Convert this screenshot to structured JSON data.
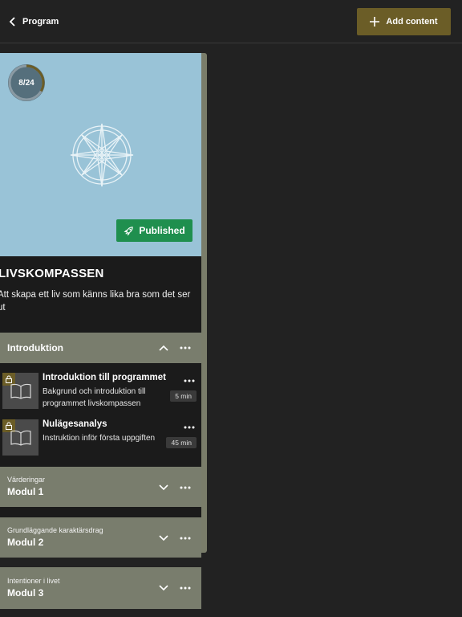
{
  "topbar": {
    "back_label": "Program",
    "add_label": "Add content"
  },
  "program": {
    "progress_text": "8/24",
    "progress_fraction": 0.333,
    "status_label": "Published",
    "title": "LIVSKOMPASSEN",
    "description": "Att skapa ett liv som känns lika bra som det ser ut"
  },
  "sections": {
    "intro": {
      "title": "Introduktion"
    },
    "lessons": [
      {
        "title": "Introduktion till programmet",
        "description": "Bakgrund och introduktion till programmet livskompassen",
        "duration": "5 min"
      },
      {
        "title": "Nulägesanalys",
        "description": "Instruktion inför första uppgiften",
        "duration": "45 min"
      }
    ],
    "modules": [
      {
        "subtitle": "Värderingar",
        "title": "Modul 1"
      },
      {
        "subtitle": "Grundläggande karaktärsdrag",
        "title": "Modul 2"
      },
      {
        "subtitle": "Intentioner i livet",
        "title": "Modul 3"
      }
    ]
  },
  "colors": {
    "background": "#222222",
    "accent": "#6b5d27",
    "hero": "#99c3d7",
    "published": "#1f8f4e",
    "section": "#797d6d"
  },
  "icons": [
    "chevron-left-icon",
    "plus-icon",
    "compass-icon",
    "rocket-icon",
    "lock-icon",
    "book-icon",
    "chevron-up-icon",
    "chevron-down-icon",
    "more-icon"
  ]
}
